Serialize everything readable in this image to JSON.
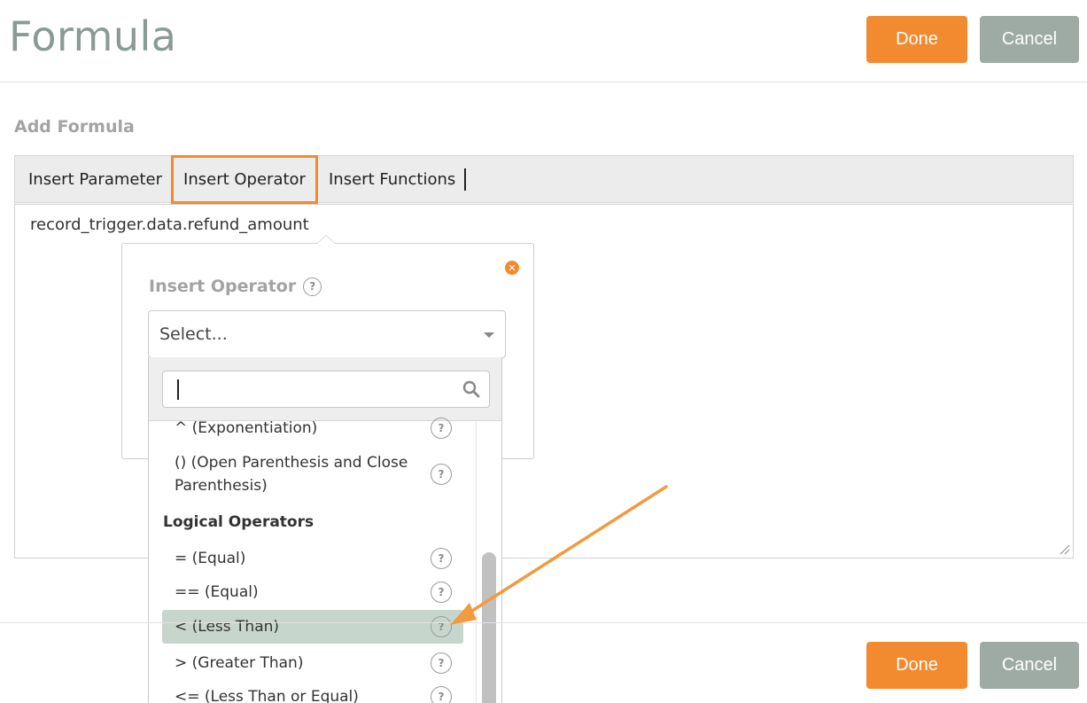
{
  "header": {
    "title": "Formula",
    "done_label": "Done",
    "cancel_label": "Cancel"
  },
  "section": {
    "label": "Add Formula"
  },
  "toolbar": {
    "items": [
      {
        "label": "Insert Parameter"
      },
      {
        "label": "Insert Operator",
        "active": true
      },
      {
        "label": "Insert Functions"
      }
    ]
  },
  "editor": {
    "value": "record_trigger.data.refund_amount"
  },
  "popover": {
    "title": "Insert Operator",
    "help_glyph": "?",
    "select": {
      "value": "Select..."
    },
    "search": {
      "value": ""
    },
    "options": [
      {
        "label": "^ (Exponentiation)"
      },
      {
        "label": "() (Open Parenthesis and Close Parenthesis)",
        "label_line1": "() (Open Parenthesis and Close",
        "label_line2": "Parenthesis)"
      },
      {
        "group": "Logical Operators"
      },
      {
        "label": "= (Equal)"
      },
      {
        "label": "== (Equal)"
      },
      {
        "label": "< (Less Than)",
        "highlighted": true
      },
      {
        "label": "> (Greater Than)"
      },
      {
        "label": "<= (Less Than or Equal)"
      }
    ]
  },
  "footer": {
    "done_label": "Done",
    "cancel_label": "Cancel"
  },
  "colors": {
    "accent": "#f28a30",
    "cancel": "#9eaba5",
    "highlight": "#c7d6cd"
  },
  "icons": {
    "close": "close-icon",
    "search": "search-icon",
    "help": "help-icon",
    "dropdown": "chevron-down-icon",
    "annotation": "arrow-annotation"
  }
}
